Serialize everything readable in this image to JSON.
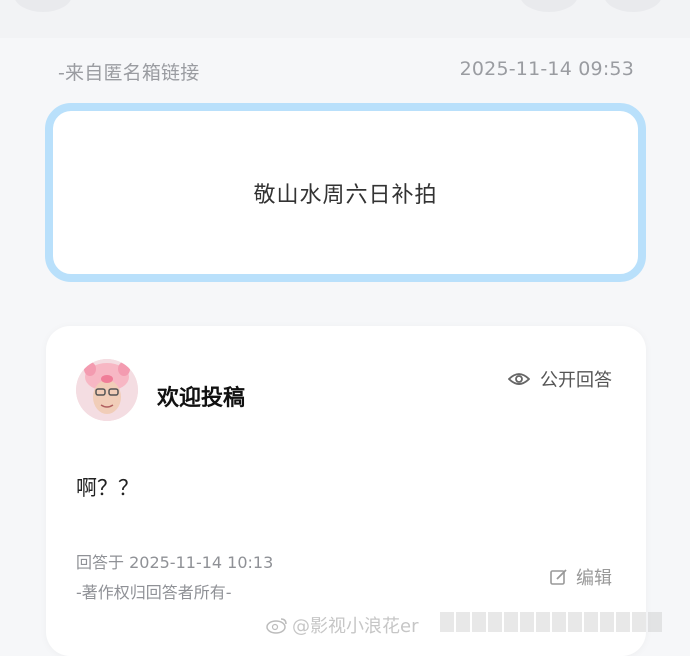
{
  "source": {
    "label": "-来自匿名箱链接",
    "timestamp": "2025-11-14 09:53"
  },
  "question": {
    "text": "敬山水周六日补拍",
    "border_color": "#b9e0fb"
  },
  "answer": {
    "author_name": "欢迎投稿",
    "visibility_label": "公开回答",
    "visibility_icon": "eye-icon",
    "content": "啊？？",
    "answered_at": "回答于 2025-11-14 10:13",
    "copyright": "-著作权归回答者所有-",
    "edit_label": "编辑",
    "edit_icon": "edit-icon"
  },
  "watermark": {
    "text": "@影视小浪花er"
  }
}
